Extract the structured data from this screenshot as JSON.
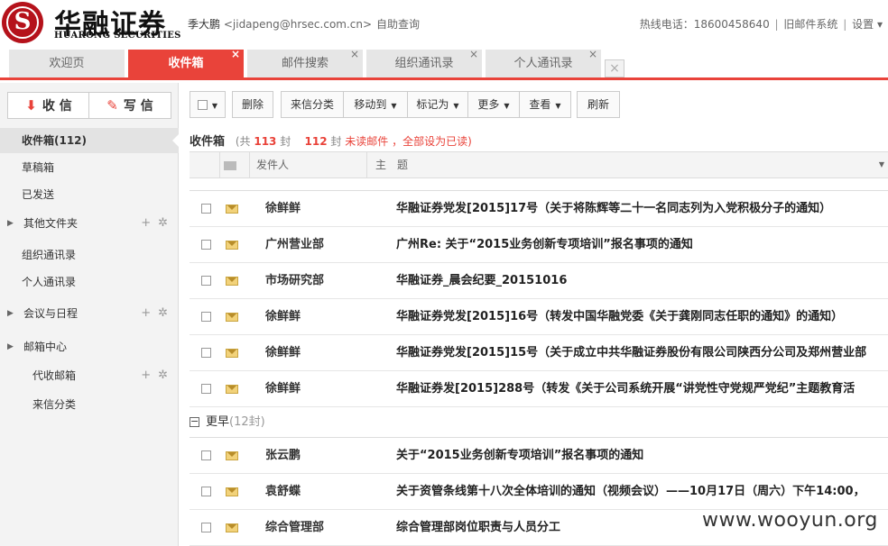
{
  "header": {
    "logo_cn": "华融证券",
    "logo_en": "HUARONG SECURITIES",
    "logo_symbol": "S",
    "user_name": "季大鹏",
    "user_email": "<jidapeng@hrsec.com.cn>",
    "self_query": "自助查询",
    "hotline": "热线电话：18600458640",
    "old_mail": "旧邮件系统",
    "settings": "设置",
    "sep": "|",
    "settings_caret": "▾"
  },
  "tabs": [
    {
      "label": "欢迎页",
      "close": ""
    },
    {
      "label": "收件箱",
      "close": "×"
    },
    {
      "label": "邮件搜索",
      "close": "×"
    },
    {
      "label": "组织通讯录",
      "close": "×"
    },
    {
      "label": "个人通讯录",
      "close": "×"
    }
  ],
  "tab_extra": "×",
  "sidebar": {
    "receive": "收 信",
    "compose": "写 信",
    "receive_icon": "⬇",
    "compose_icon": "✎",
    "items": [
      {
        "label": "收件箱(112)"
      },
      {
        "label": "草稿箱"
      },
      {
        "label": "已发送"
      },
      {
        "label": "其他文件夹"
      },
      {
        "label": "组织通讯录"
      },
      {
        "label": "个人通讯录"
      },
      {
        "label": "会议与日程"
      },
      {
        "label": "邮箱中心"
      },
      {
        "label": "代收邮箱"
      },
      {
        "label": "来信分类"
      }
    ],
    "arrow": "▶",
    "add": "+",
    "gear": "✲"
  },
  "toolbar": {
    "select_caret": "▼",
    "delete": "删除",
    "classify": "来信分类",
    "move_to": "移动到",
    "mark_as": "标记为",
    "more": "更多",
    "view": "查看",
    "refresh": "刷新",
    "caret": "▼"
  },
  "summary": {
    "folder": "收件箱",
    "total_prefix": "(共",
    "total": "113",
    "total_suffix": "封",
    "unread": "112",
    "unread_suffix": "封",
    "unread_label": "未读邮件",
    "mark_all": "，全部设为已读)"
  },
  "table": {
    "col_sender": "发件人",
    "col_subject": "主　题",
    "sort_caret": "▼"
  },
  "rows_recent": [
    {
      "sender": "徐鲜鲜",
      "subject": "华融证券党发[2015]17号（关于将陈辉等二十一名同志列为入党积极分子的通知）"
    },
    {
      "sender": "广州营业部",
      "subject": "广州Re: 关于“2015业务创新专项培训”报名事项的通知"
    },
    {
      "sender": "市场研究部",
      "subject": "华融证券_晨会纪要_20151016"
    },
    {
      "sender": "徐鲜鲜",
      "subject": "华融证券党发[2015]16号（转发中国华融党委《关于龚刚同志任职的通知》的通知）"
    },
    {
      "sender": "徐鲜鲜",
      "subject": "华融证券党发[2015]15号（关于成立中共华融证券股份有限公司陕西分公司及郑州营业部"
    },
    {
      "sender": "徐鲜鲜",
      "subject": "华融证券发[2015]288号（转发《关于公司系统开展“讲党性守党规严党纪”主题教育活"
    }
  ],
  "group": {
    "toggle": "−",
    "label": "更早",
    "count": "(12封)"
  },
  "rows_earlier": [
    {
      "sender": "张云鹏",
      "subject": "关于“2015业务创新专项培训”报名事项的通知"
    },
    {
      "sender": "袁舒蝶",
      "subject": "关于资管条线第十八次全体培训的通知（视频会议）——10月17日（周六）下午14:00，"
    },
    {
      "sender": "综合管理部",
      "subject": "综合管理部岗位职责与人员分工"
    }
  ],
  "watermark": "www.wooyun.org"
}
